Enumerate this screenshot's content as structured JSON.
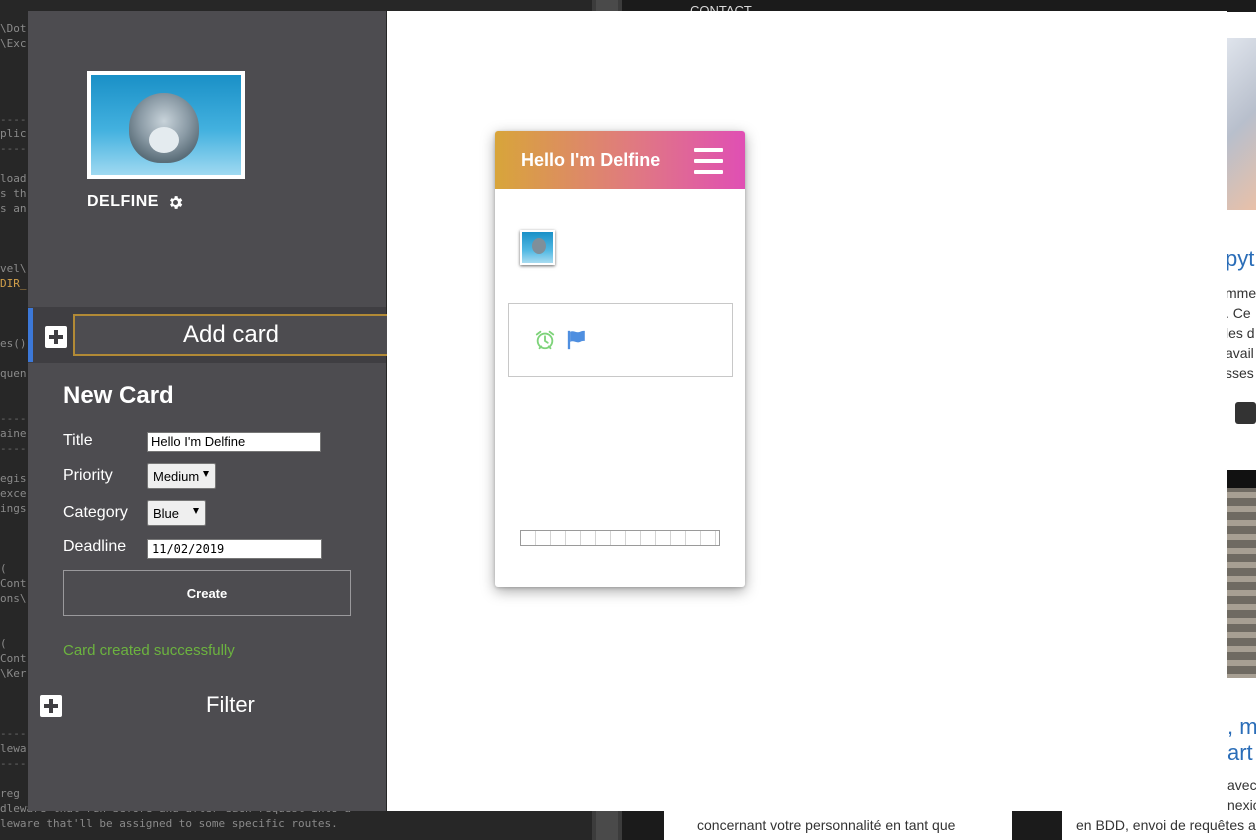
{
  "background": {
    "editor_lines": [
      {
        "text": "\\Dot",
        "accent": false
      },
      {
        "text": "\\Exc",
        "accent": false
      },
      {
        "text": "----",
        "accent": false
      },
      {
        "text": "plic",
        "accent": false
      },
      {
        "text": "----",
        "accent": false
      },
      {
        "text": "load",
        "accent": false
      },
      {
        "text": "s th",
        "accent": false
      },
      {
        "text": "s an",
        "accent": false
      },
      {
        "text": "vel\\",
        "accent": false
      },
      {
        "text": "DIR_",
        "accent": true
      },
      {
        "text": "es()",
        "accent": false
      },
      {
        "text": "quen",
        "accent": false
      },
      {
        "text": "----",
        "accent": false
      },
      {
        "text": "aine",
        "accent": false
      },
      {
        "text": "----",
        "accent": false
      },
      {
        "text": "egis",
        "accent": false
      },
      {
        "text": "exce",
        "accent": false
      },
      {
        "text": "ings",
        "accent": false
      },
      {
        "text": "(",
        "accent": false
      },
      {
        "text": "Cont",
        "accent": false
      },
      {
        "text": "ons\\",
        "accent": false
      },
      {
        "text": "(",
        "accent": false
      },
      {
        "text": "Cont",
        "accent": false
      },
      {
        "text": "\\Ker",
        "accent": false
      },
      {
        "text": "----",
        "accent": false
      },
      {
        "text": "lewa",
        "accent": false
      },
      {
        "text": "----",
        "accent": false
      },
      {
        "text": " reg",
        "accent": false
      },
      {
        "text": "dleware that run before and after each request into a",
        "accent": false
      },
      {
        "text": "leware that'll be assigned to some specific routes.",
        "accent": false
      }
    ],
    "site": {
      "nav_contact": "CONTACT",
      "heading_1": "pyt",
      "para_1": [
        "mme",
        ". Ce",
        "les d",
        "avail",
        "sses"
      ],
      "heading_2a": ", m",
      "heading_2b": "art",
      "para_2": [
        "avec",
        "nexic"
      ],
      "bottom_left": "concernant votre personnalité en tant que",
      "bottom_right": "en BDD, envoi de requêtes a"
    }
  },
  "sidebar": {
    "profile_name": "DELFINE",
    "add_card_label": "Add card",
    "filter_label": "Filter"
  },
  "form": {
    "heading": "New Card",
    "title_label": "Title",
    "title_value": "Hello I'm Delfine",
    "priority_label": "Priority",
    "priority_value": "Medium",
    "category_label": "Category",
    "category_value": "Blue",
    "deadline_label": "Deadline",
    "deadline_value": "11/02/2019",
    "create_label": "Create",
    "success_message": "Card created successfully"
  },
  "card": {
    "title": "Hello I'm Delfine",
    "progress": 0
  },
  "colors": {
    "accent_blue": "#3c78d8",
    "success_green": "#6cb33f",
    "header_gradient_start": "#d8a53a",
    "header_gradient_end": "#e04fb4"
  }
}
